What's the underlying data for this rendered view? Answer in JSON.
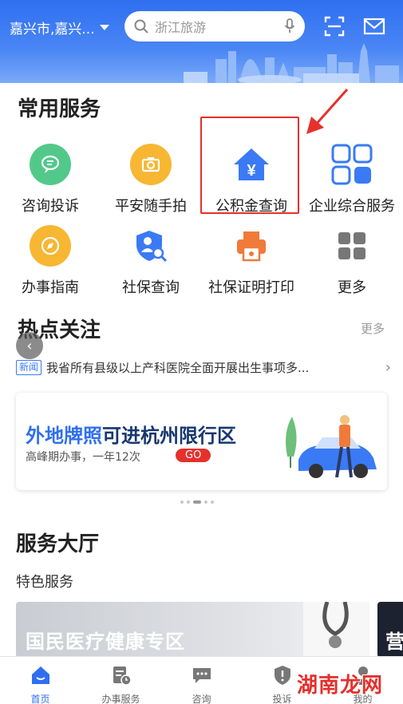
{
  "header": {
    "location": "嘉兴市,嘉兴...",
    "search_placeholder": "浙江旅游"
  },
  "common_services": {
    "title": "常用服务",
    "items": [
      {
        "label": "咨询投诉",
        "icon": "chat-bubble-icon",
        "color": "#52c98a"
      },
      {
        "label": "平安随手拍",
        "icon": "camera-icon",
        "color": "#f7b733"
      },
      {
        "label": "公积金查询",
        "icon": "house-yen-icon",
        "color": "#3a7af5"
      },
      {
        "label": "企业综合服务",
        "icon": "grid-four-icon",
        "color": "#3a7af5"
      },
      {
        "label": "办事指南",
        "icon": "compass-icon",
        "color": "#f7b733"
      },
      {
        "label": "社保查询",
        "icon": "shield-search-icon",
        "color": "#3a7af5"
      },
      {
        "label": "社保证明打印",
        "icon": "printer-icon",
        "color": "#f07a3a"
      },
      {
        "label": "更多",
        "icon": "more-grid-icon",
        "color": "#777777"
      }
    ]
  },
  "hot_topics": {
    "title": "热点关注",
    "more": "更多",
    "news_tag": "新闻",
    "news_text": "我省所有县级以上产科医院全面开展出生事项多..."
  },
  "banner": {
    "title_part1": "外地牌照",
    "title_part2": "可进杭州限行区",
    "subtitle": "高峰期办事，一年12次",
    "button": "GO"
  },
  "service_hall": {
    "title": "服务大厅",
    "subtitle": "特色服务",
    "card1": "国民医疗健康专区",
    "card2": "营"
  },
  "tabbar": {
    "items": [
      {
        "label": "首页",
        "icon": "home-icon",
        "active": true
      },
      {
        "label": "办事服务",
        "icon": "document-clock-icon",
        "active": false
      },
      {
        "label": "咨询",
        "icon": "message-icon",
        "active": false
      },
      {
        "label": "投诉",
        "icon": "shield-alert-icon",
        "active": false
      },
      {
        "label": "我的",
        "icon": "person-icon",
        "active": false
      }
    ]
  },
  "watermark": "湖南龙网",
  "colors": {
    "primary": "#2f6ff0",
    "highlight": "#e5302c"
  }
}
